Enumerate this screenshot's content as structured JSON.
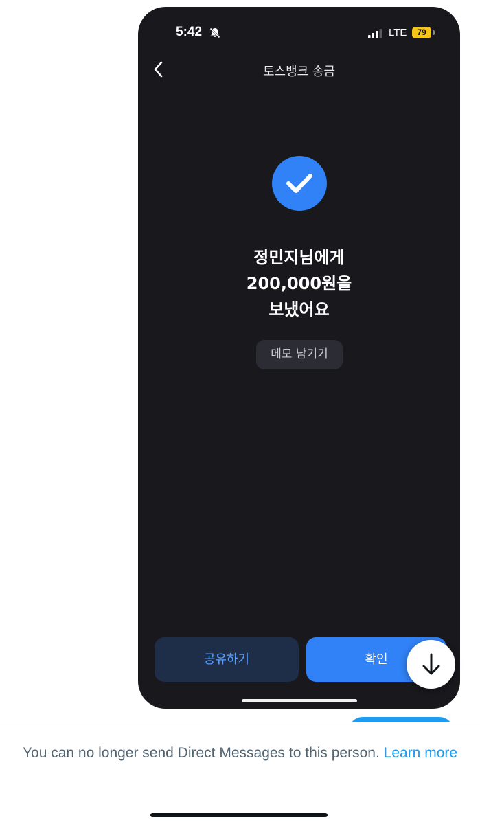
{
  "status_bar": {
    "time": "5:42",
    "network": "LTE",
    "battery": "79"
  },
  "nav": {
    "title": "토스뱅크 송금"
  },
  "result": {
    "line1": "정민지님에게",
    "line2": "200,000원을",
    "line3": "보냈어요"
  },
  "memo_button_label": "메모 남기기",
  "buttons": {
    "share_label": "공유하기",
    "confirm_label": "확인"
  },
  "notice": {
    "text": "You can no longer send Direct Messages to this person.",
    "link": "Learn more"
  },
  "colors": {
    "phone_bg": "#18181d",
    "accent_blue": "#3182f6",
    "share_bg": "#1e2d48",
    "twitter_blue": "#1d9bf0"
  },
  "icons": {
    "back": "chevron-left-icon",
    "check": "check-icon",
    "bell": "bell-slash-icon",
    "signal": "signal-bars-icon",
    "scroll": "arrow-down-icon"
  }
}
